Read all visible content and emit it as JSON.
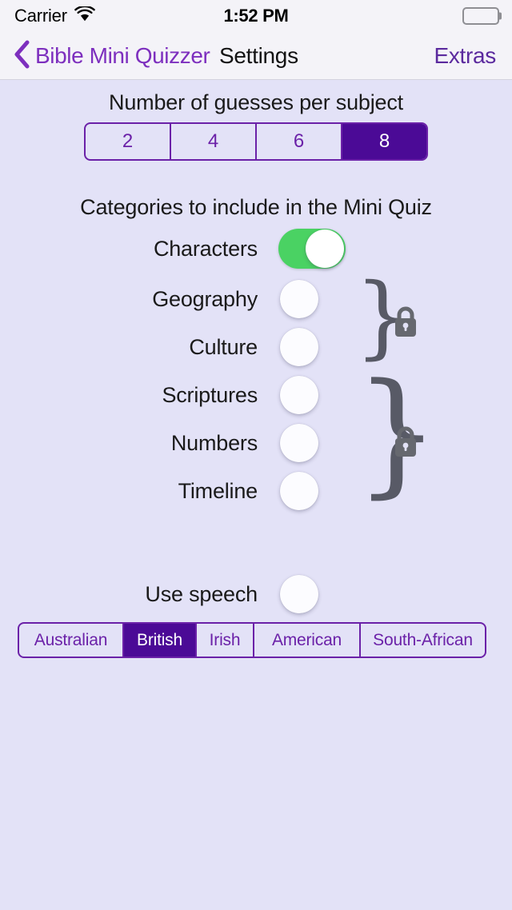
{
  "status_bar": {
    "carrier": "Carrier",
    "wifi_icon": "wifi-icon",
    "time": "1:52 PM",
    "battery_icon": "battery-full-icon"
  },
  "nav_bar": {
    "back_icon": "chevron-left-icon",
    "back_label": "Bible Mini Quizzer",
    "title": "Settings",
    "right_label": "Extras"
  },
  "guesses": {
    "heading": "Number of guesses per subject",
    "options": [
      "2",
      "4",
      "6",
      "8"
    ],
    "selected": "8"
  },
  "categories": {
    "heading": "Categories to include in the Mini Quiz",
    "items": [
      {
        "label": "Characters",
        "state": "on",
        "locked": false
      },
      {
        "label": "Geography",
        "state": "off",
        "locked": true
      },
      {
        "label": "Culture",
        "state": "off",
        "locked": true
      },
      {
        "label": "Scriptures",
        "state": "off",
        "locked": true
      },
      {
        "label": "Numbers",
        "state": "off",
        "locked": true
      },
      {
        "label": "Timeline",
        "state": "off",
        "locked": true
      }
    ],
    "lock_groups": [
      {
        "brace": "}",
        "lock_icon": "lock-closed-icon",
        "members": [
          "Geography",
          "Culture"
        ]
      },
      {
        "brace": "}",
        "lock_icon": "lock-closed-icon",
        "members": [
          "Scriptures",
          "Numbers",
          "Timeline"
        ]
      }
    ]
  },
  "speech": {
    "label": "Use speech",
    "state": "off",
    "accents": [
      "Australian",
      "British",
      "Irish",
      "American",
      "South-African"
    ],
    "selected_accent": "British"
  },
  "colors": {
    "background": "#E3E2F7",
    "bar_background": "#F4F3F8",
    "accent_purple": "#4B0A96",
    "link_purple": "#7D2FBE",
    "toggle_on_green": "#4AD263",
    "lock_gray": "#66686F"
  }
}
